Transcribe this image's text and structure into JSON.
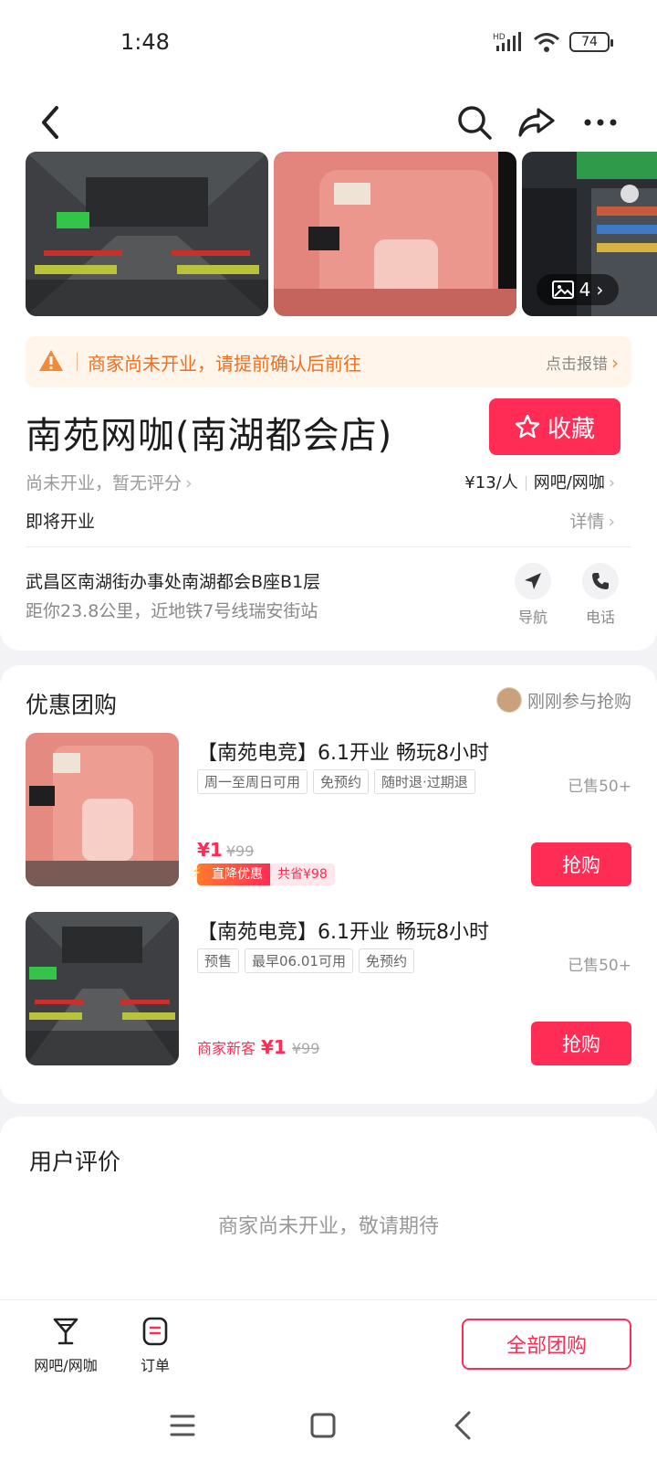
{
  "status": {
    "time": "1:48",
    "battery": "74",
    "network_badge": "HD"
  },
  "nav": {
    "icons": [
      "back-icon",
      "search-icon",
      "share-icon",
      "more-icon"
    ]
  },
  "gallery": {
    "photo_count": "4"
  },
  "notice": {
    "text": "商家尚未开业，请提前确认后前往",
    "report": "点击报错"
  },
  "shop": {
    "name": "南苑网咖(南湖都会店)",
    "favorite_label": "收藏",
    "rating_text": "尚未开业，暂无评分",
    "price": "¥13/人",
    "category": "网吧/网咖",
    "open_status": "即将开业",
    "details_label": "详情",
    "address": "武昌区南湖街办事处南湖都会B座B1层",
    "distance": "距你23.8公里，近地铁7号线瑞安街站",
    "navigate_label": "导航",
    "phone_label": "电话"
  },
  "deals": {
    "title": "优惠团购",
    "joined_text": "刚刚参与抢购",
    "items": [
      {
        "title": "【南苑电竞】6.1开业 畅玩8小时",
        "tags": [
          "周一至周日可用",
          "免预约",
          "随时退·过期退"
        ],
        "sold": "已售50+",
        "price": "¥1",
        "original_price": "¥99",
        "promo_label": "直降优惠",
        "promo_save": "共省¥98",
        "buy_label": "抢购"
      },
      {
        "title": "【南苑电竞】6.1开业 畅玩8小时",
        "tags": [
          "预售",
          "最早06.01可用",
          "免预约"
        ],
        "sold": "已售50+",
        "newcust_label": "商家新客",
        "price": "¥1",
        "original_price": "¥99",
        "buy_label": "抢购"
      }
    ]
  },
  "reviews": {
    "title": "用户评价",
    "empty_text": "商家尚未开业，敬请期待"
  },
  "bottom": {
    "tab_category": "网吧/网咖",
    "tab_orders": "订单",
    "all_deals_label": "全部团购"
  },
  "colors": {
    "accent": "#ff2d55",
    "warning": "#ee6f22",
    "notice_bg": "#fff5ea"
  }
}
